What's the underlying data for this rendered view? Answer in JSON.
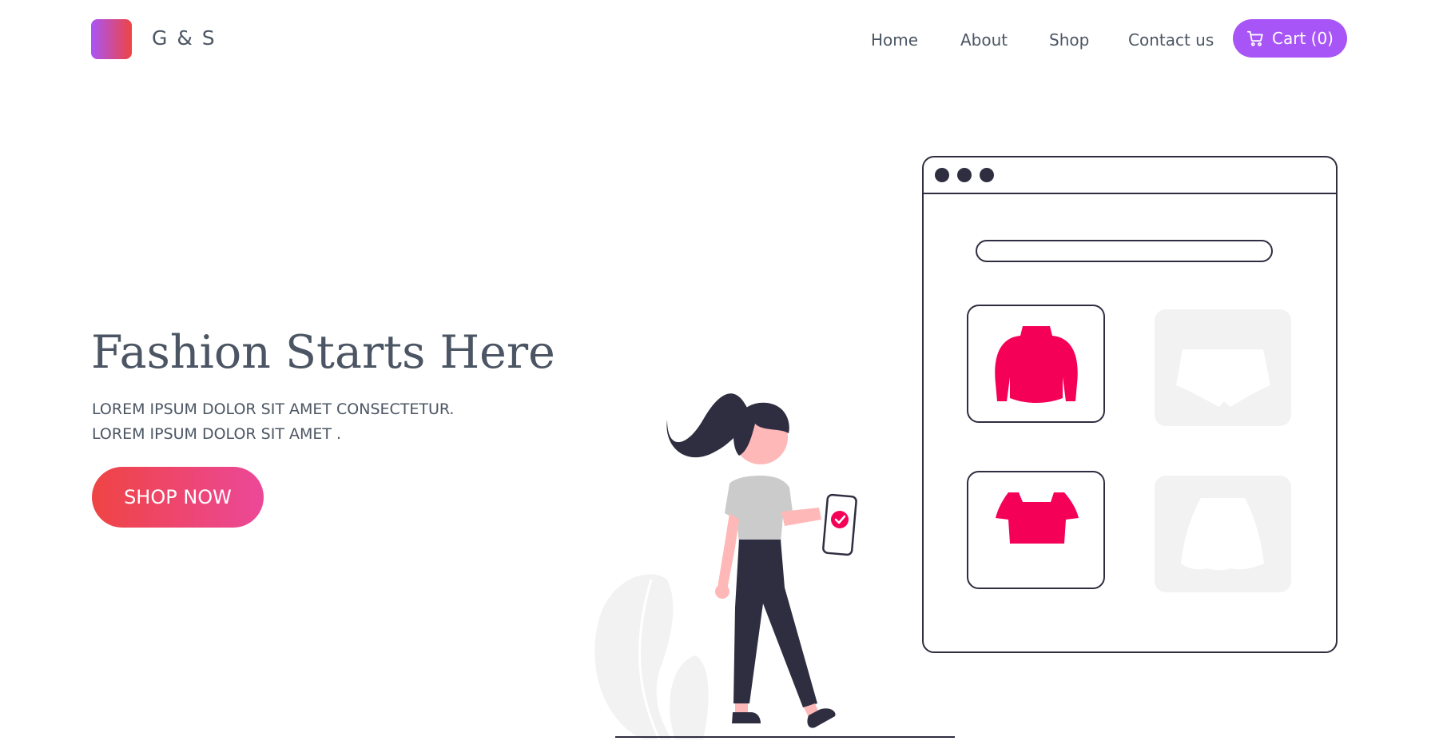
{
  "brand": {
    "name": "G & S",
    "logo_colors": [
      "#a855f7",
      "#ef4444"
    ]
  },
  "nav": {
    "items": [
      {
        "label": "Home"
      },
      {
        "label": "About"
      },
      {
        "label": "Shop"
      },
      {
        "label": "Contact us"
      }
    ],
    "cart_label": "Cart (0)",
    "cart_icon": "cart-icon"
  },
  "hero": {
    "title": "Fashion Starts Here",
    "subtitle_line1": "LOREM IPSUM DOLOR SIT AMET CONSECTETUR.",
    "subtitle_line2": "LOREM IPSUM DOLOR SIT AMET .",
    "cta_label": "SHOP NOW"
  },
  "colors": {
    "accent_purple": "#a855f7",
    "cta_gradient": [
      "#ef4444",
      "#ec4899"
    ],
    "product_pink": "#f50057",
    "ink": "#2f2e41",
    "text": "#4b5563"
  }
}
